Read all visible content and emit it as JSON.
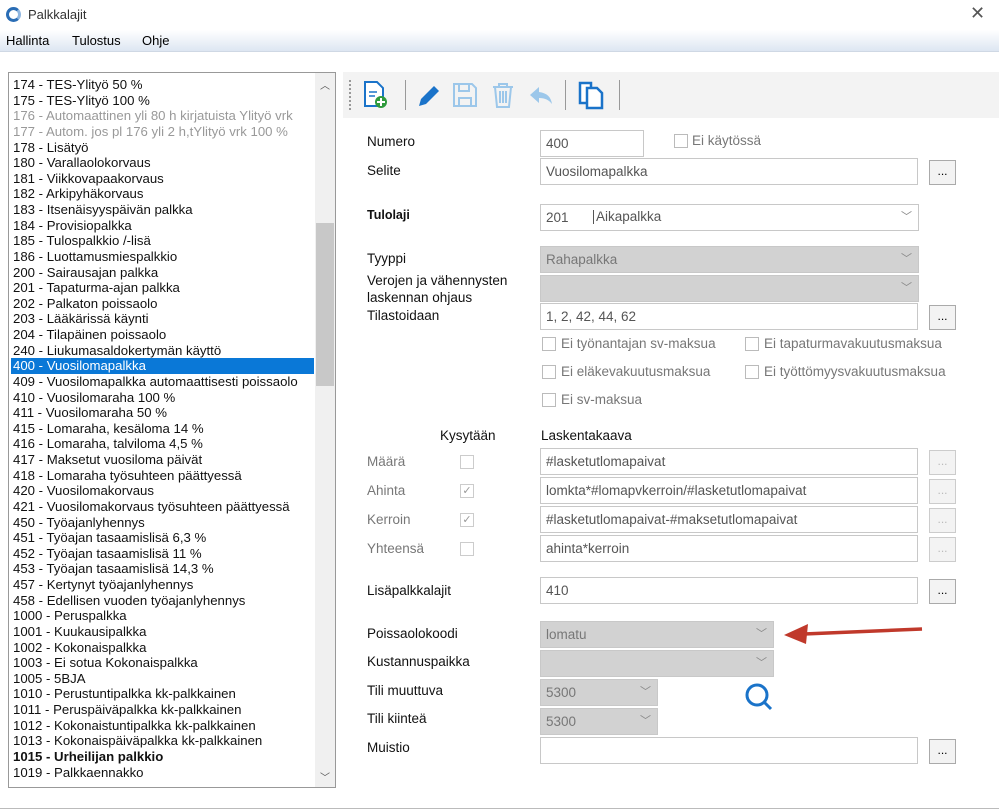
{
  "window": {
    "title": "Palkkalajit",
    "close": "✕"
  },
  "menu": [
    "Hallinta",
    "Tulostus",
    "Ohje"
  ],
  "list": [
    {
      "t": "174 - TES-Ylityö 50 %"
    },
    {
      "t": "175 - TES-Ylityö 100 %"
    },
    {
      "t": "176 - Automaattinen yli 80 h kirjatuista Ylityö vrk",
      "s": "dis"
    },
    {
      "t": "177 - Autom. jos pl 176 yli 2 h,tYlityö vrk 100 %",
      "s": "dis"
    },
    {
      "t": "178 - Lisätyö"
    },
    {
      "t": "180 - Varallaolokorvaus"
    },
    {
      "t": "181 - Viikkovapaakorvaus"
    },
    {
      "t": "182 - Arkipyhäkorvaus"
    },
    {
      "t": "183 - Itsenäisyyspäivän palkka"
    },
    {
      "t": "184 - Provisiopalkka"
    },
    {
      "t": "185 - Tulospalkkio /-lisä"
    },
    {
      "t": "186 - Luottamusmiespalkkio"
    },
    {
      "t": "200 - Sairausajan palkka"
    },
    {
      "t": "201 - Tapaturma-ajan palkka"
    },
    {
      "t": "202 - Palkaton poissaolo"
    },
    {
      "t": "203 - Lääkärissä käynti"
    },
    {
      "t": "204 - Tilapäinen poissaolo"
    },
    {
      "t": "240 - Liukumasaldokertymän käyttö"
    },
    {
      "t": "400 - Vuosilomapalkka",
      "s": "sel"
    },
    {
      "t": "409 - Vuosilomapalkka automaattisesti poissaolo"
    },
    {
      "t": "410 - Vuosilomaraha 100 %"
    },
    {
      "t": "411 - Vuosilomaraha 50 %"
    },
    {
      "t": "415 - Lomaraha, kesäloma 14 %"
    },
    {
      "t": "416 - Lomaraha, talviloma 4,5 %"
    },
    {
      "t": "417 - Maksetut vuosiloma päivät"
    },
    {
      "t": "418 - Lomaraha työsuhteen päättyessä"
    },
    {
      "t": "420 - Vuosilomakorvaus"
    },
    {
      "t": "421 - Vuosilomakorvaus työsuhteen päättyessä"
    },
    {
      "t": "450 - Työajanlyhennys"
    },
    {
      "t": "451 - Työajan tasaamislisä 6,3 %"
    },
    {
      "t": "452 - Työajan tasaamislisä 11 %"
    },
    {
      "t": "453 - Työajan tasaamislisä 14,3 %"
    },
    {
      "t": "457 - Kertynyt työajanlyhennys"
    },
    {
      "t": "458 - Edellisen vuoden työajanlyhennys"
    },
    {
      "t": "1000 - Peruspalkka"
    },
    {
      "t": "1001 - Kuukausipalkka"
    },
    {
      "t": "1002 - Kokonaispalkka"
    },
    {
      "t": "1003 - Ei sotua Kokonaispalkka"
    },
    {
      "t": "1005 - 5BJA"
    },
    {
      "t": "1010 - Perustuntipalkka kk-palkkainen"
    },
    {
      "t": "1011 - Peruspäiväpalkka kk-palkkainen"
    },
    {
      "t": "1012 - Kokonaistuntipalkka kk-palkkainen"
    },
    {
      "t": "1013 - Kokonaispäiväpalkka kk-palkkainen"
    },
    {
      "t": "1015 - Urheilijan palkkio",
      "s": "b"
    },
    {
      "t": "1019 - Palkkaennakko"
    }
  ],
  "form": {
    "numero_label": "Numero",
    "numero": "400",
    "ei_kaytossa": "Ei käytössä",
    "selite_label": "Selite",
    "selite": "Vuosilomapalkka",
    "tulolaji_label": "Tulolaji",
    "tulolaji_code": "201",
    "tulolaji_name": "Aikapalkka",
    "tyyppi_label": "Tyyppi",
    "tyyppi": "Rahapalkka",
    "verojen_label1": "Verojen ja vähennysten",
    "verojen_label2": "laskennan ohjaus",
    "tilastoidaan_label": "Tilastoidaan",
    "tilastoidaan": "1, 2, 42, 44, 62",
    "checks": [
      "Ei työnantajan sv-maksua",
      "Ei tapaturmavakuutusmaksua",
      "Ei eläkevakuutusmaksua",
      "Ei työttömyysvakuutusmaksua",
      "Ei sv-maksua"
    ],
    "kysytaan": "Kysytään",
    "laskentakaava": "Laskentakaava",
    "rows": [
      {
        "label": "Määrä",
        "checked": false,
        "formula": "#lasketutlomapaivat"
      },
      {
        "label": "Ahinta",
        "checked": true,
        "formula": "lomkta*#lomapvkerroin/#lasketutlomapaivat"
      },
      {
        "label": "Kerroin",
        "checked": true,
        "formula": "#lasketutlomapaivat-#maksetutlomapaivat"
      },
      {
        "label": "Yhteensä",
        "checked": false,
        "formula": "ahinta*kerroin"
      }
    ],
    "lisapalkkalajit_label": "Lisäpalkkalajit",
    "lisapalkkalajit": "410",
    "poissaolokoodi_label": "Poissaolokoodi",
    "poissaolokoodi": "lomatu",
    "kustannuspaikka_label": "Kustannuspaikka",
    "tili_muuttuva_label": "Tili muuttuva",
    "tili_muuttuva": "5300",
    "tili_kiintea_label": "Tili kiinteä",
    "tili_kiintea": "5300",
    "muistio_label": "Muistio",
    "ellipsis": "...",
    "checkmark": "✓"
  },
  "colors": {
    "selection": "#0a78d7",
    "arrow": "#c0392b"
  }
}
